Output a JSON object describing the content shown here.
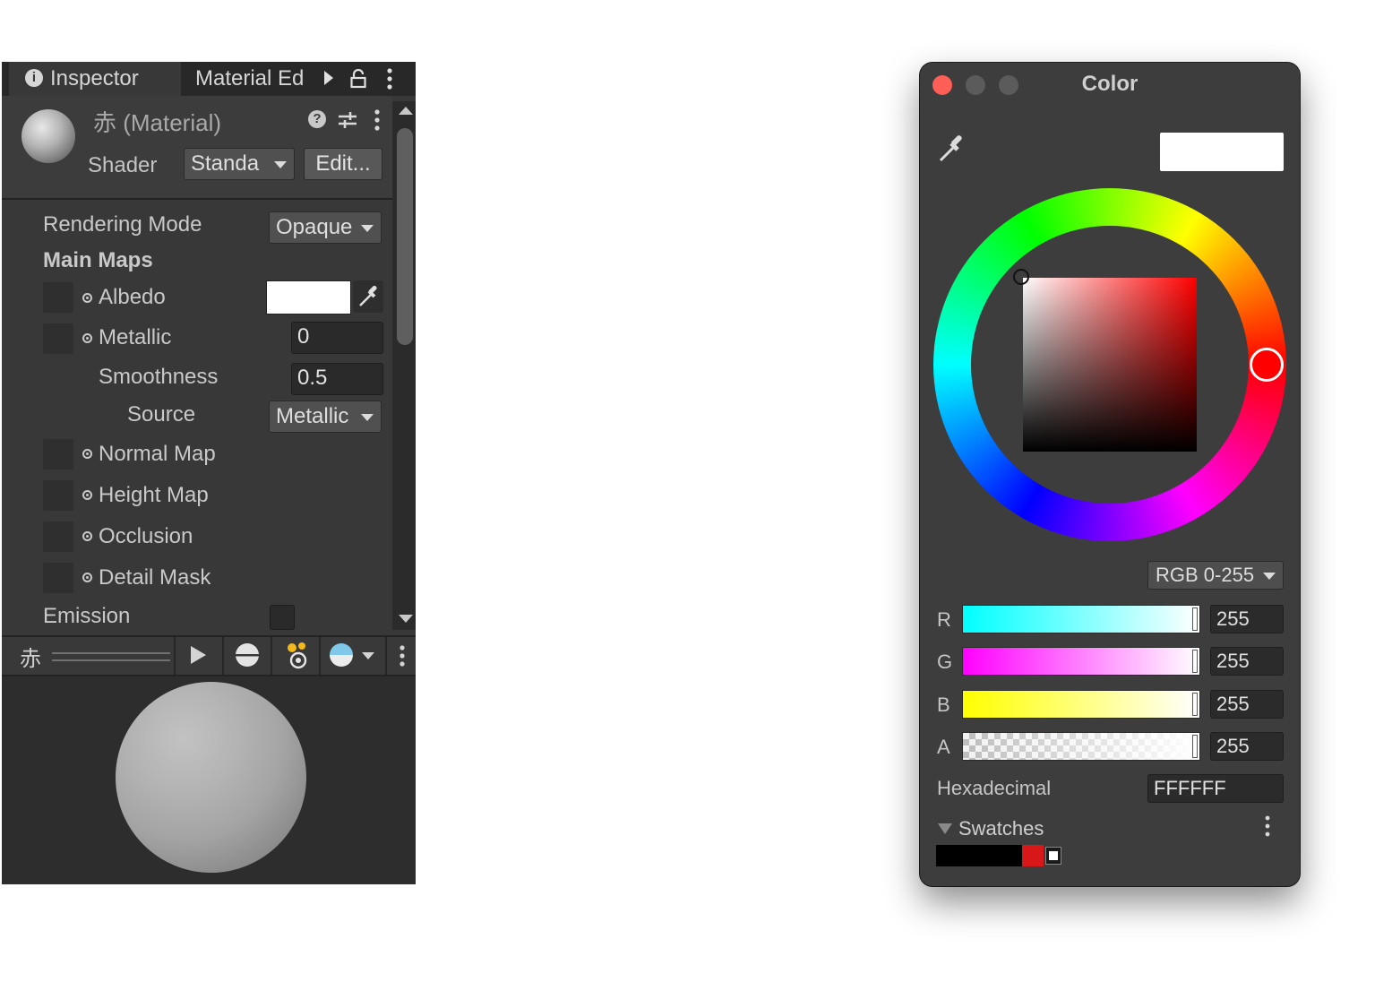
{
  "inspector": {
    "tabs": {
      "inspector": "Inspector",
      "material_editor": "Material Ed"
    },
    "material_title": "赤 (Material)",
    "shader_label": "Shader",
    "shader_value": "Standa",
    "edit_label": "Edit...",
    "rendering_mode_label": "Rendering Mode",
    "rendering_mode_value": "Opaque",
    "main_maps_label": "Main Maps",
    "albedo_label": "Albedo",
    "albedo_color": "#ffffff",
    "metallic_label": "Metallic",
    "metallic_value": "0",
    "smoothness_label": "Smoothness",
    "smoothness_value": "0.5",
    "source_label": "Source",
    "source_value": "Metallic",
    "normal_map_label": "Normal Map",
    "height_map_label": "Height Map",
    "occlusion_label": "Occlusion",
    "detail_mask_label": "Detail Mask",
    "emission_label": "Emission",
    "emission_checked": false,
    "preview_name": "赤",
    "icons": [
      "info-icon",
      "play-arrow-icon",
      "lock-icon",
      "kebab-menu-icon",
      "help-icon",
      "preset-icon",
      "eyedropper-icon",
      "play-icon",
      "sphere-mode-icon",
      "light-icon",
      "background-sphere-icon"
    ]
  },
  "color_window": {
    "title": "Color",
    "current_color": "#ffffff",
    "mode_value": "RGB 0-255",
    "channels": [
      {
        "label": "R",
        "value": "255"
      },
      {
        "label": "G",
        "value": "255"
      },
      {
        "label": "B",
        "value": "255"
      },
      {
        "label": "A",
        "value": "255"
      }
    ],
    "hex_label": "Hexadecimal",
    "hex_value": "FFFFFF",
    "swatches_label": "Swatches",
    "swatch_colors": [
      "#000000",
      "#d81818"
    ],
    "selected_hue_color": "#ff0000",
    "icons": [
      "close-icon",
      "minimize-icon",
      "zoom-icon",
      "eyedropper-icon",
      "kebab-menu-icon"
    ]
  }
}
